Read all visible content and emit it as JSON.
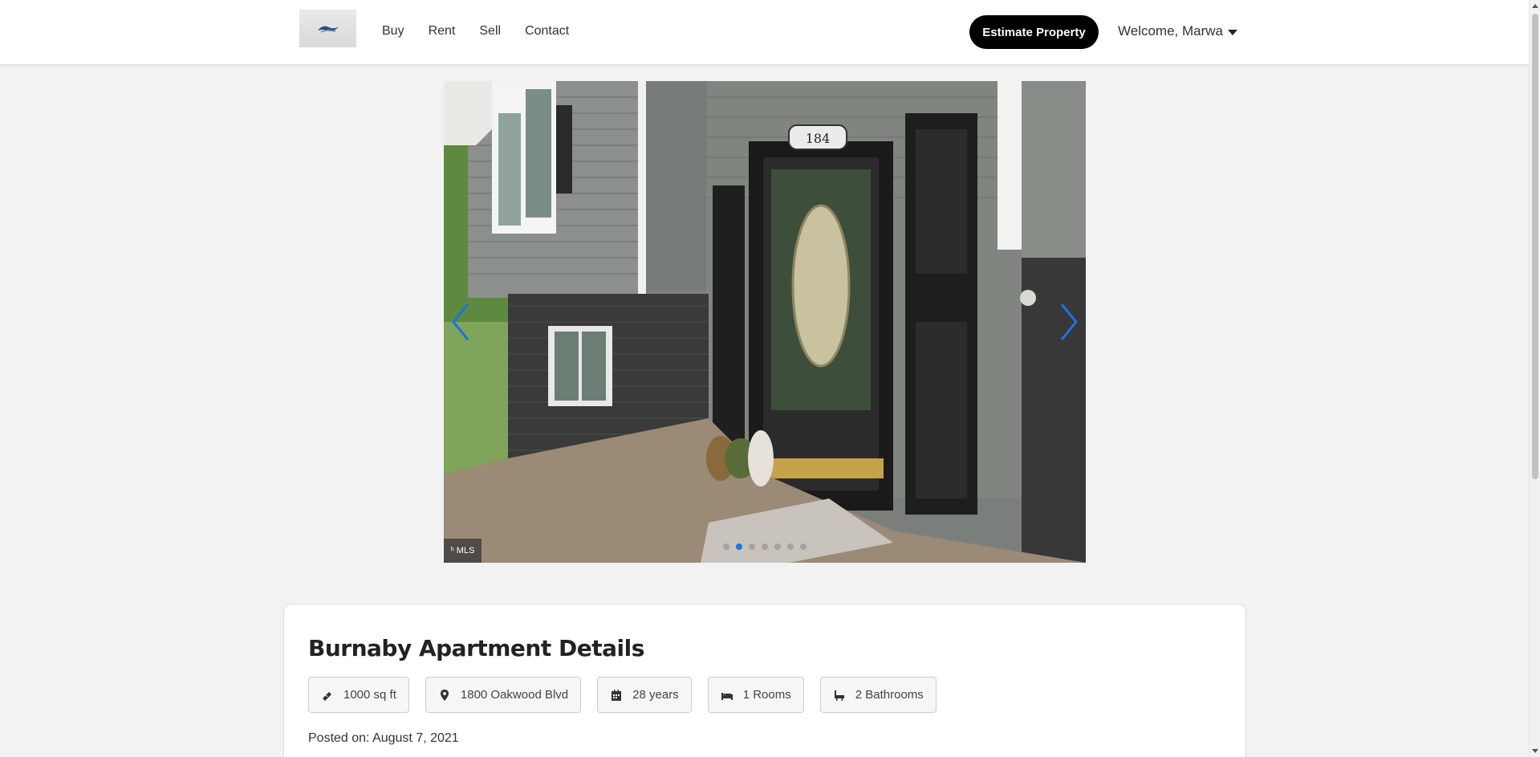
{
  "header": {
    "logo_alt": "logo",
    "nav": [
      "Buy",
      "Rent",
      "Sell",
      "Contact"
    ],
    "estimate_label": "Estimate Property",
    "welcome_label": "Welcome, Marwa"
  },
  "carousel": {
    "house_number": "184",
    "badge_text": "MLS",
    "total_slides": 7,
    "active_slide": 2
  },
  "details": {
    "title": "Burnaby Apartment Details",
    "chips": [
      {
        "icon": "ruler-icon",
        "label": "1000 sq ft"
      },
      {
        "icon": "location-pin-icon",
        "label": "1800 Oakwood Blvd"
      },
      {
        "icon": "calendar-icon",
        "label": "28 years"
      },
      {
        "icon": "bed-icon",
        "label": "1 Rooms"
      },
      {
        "icon": "bath-icon",
        "label": "2 Bathrooms"
      }
    ],
    "posted_label": "Posted on:",
    "posted_date": "August 7, 2021"
  },
  "colors": {
    "accent": "#1a73e8",
    "button_bg": "#000000",
    "page_bg": "#f2f2f2"
  }
}
